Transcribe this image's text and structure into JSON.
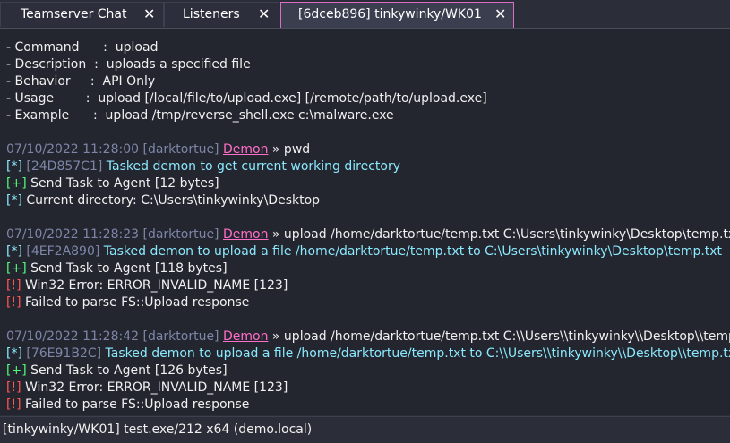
{
  "tabs": [
    {
      "label": "Teamserver Chat",
      "close": "✕"
    },
    {
      "label": "Listeners",
      "close": "✕"
    },
    {
      "label": "[6dceb896] tinkywinky/WK01",
      "close": "✕"
    }
  ],
  "help": {
    "command": "- Command      :  upload",
    "description": "- Description  :  uploads a specified file",
    "behavior": "- Behavior     :  API Only",
    "usage": "- Usage        :  upload [/local/file/to/upload.exe] [/remote/path/to/upload.exe]",
    "example": "- Example      :  upload /tmp/reverse_shell.exe c:\\malware.exe"
  },
  "blocks": [
    {
      "timestamp": "07/10/2022 11:28:00",
      "user": "[darktortue]",
      "agent": "Demon",
      "command": " » pwd",
      "lines": [
        {
          "tag": "[*]",
          "id": "[24D857C1]",
          "text": " Tasked demon to get current working directory",
          "kind": "info"
        },
        {
          "tag": "[+]",
          "text": " Send Task to Agent [12 bytes]",
          "kind": "ok"
        },
        {
          "tag": "[*]",
          "text": " Current directory: C:\\Users\\tinkywinky\\Desktop",
          "kind": "plain"
        }
      ]
    },
    {
      "timestamp": "07/10/2022 11:28:23",
      "user": "[darktortue]",
      "agent": "Demon",
      "command": " » upload /home/darktortue/temp.txt C:\\Users\\tinkywinky\\Desktop\\temp.txt",
      "lines": [
        {
          "tag": "[*]",
          "id": "[4EF2A890]",
          "text": " Tasked demon to upload a file /home/darktortue/temp.txt to C:\\Users\\tinkywinky\\Desktop\\temp.txt",
          "kind": "info"
        },
        {
          "tag": "[+]",
          "text": " Send Task to Agent [118 bytes]",
          "kind": "ok"
        },
        {
          "tag": "[!]",
          "text": " Win32 Error: ERROR_INVALID_NAME [123]",
          "kind": "err"
        },
        {
          "tag": "[!]",
          "text": " Failed to parse FS::Upload response",
          "kind": "err"
        }
      ]
    },
    {
      "timestamp": "07/10/2022 11:28:42",
      "user": "[darktortue]",
      "agent": "Demon",
      "command": " » upload /home/darktortue/temp.txt C:\\\\Users\\\\tinkywinky\\\\Desktop\\\\temp.txt",
      "lines": [
        {
          "tag": "[*]",
          "id": "[76E91B2C]",
          "text": " Tasked demon to upload a file /home/darktortue/temp.txt to C:\\\\Users\\\\tinkywinky\\\\Desktop\\\\temp.txt",
          "kind": "info"
        },
        {
          "tag": "[+]",
          "text": " Send Task to Agent [126 bytes]",
          "kind": "ok"
        },
        {
          "tag": "[!]",
          "text": " Win32 Error: ERROR_INVALID_NAME [123]",
          "kind": "err"
        },
        {
          "tag": "[!]",
          "text": " Failed to parse FS::Upload response",
          "kind": "err"
        }
      ]
    }
  ],
  "status": "[tinkywinky/WK01] test.exe/212 x64 (demo.local)",
  "colors": {
    "accent": "#d96ec2",
    "demon": "#ff6ec7",
    "info": "#8be9fd",
    "ok": "#50fa7b",
    "error": "#ff5555",
    "muted": "#7e86a8"
  }
}
